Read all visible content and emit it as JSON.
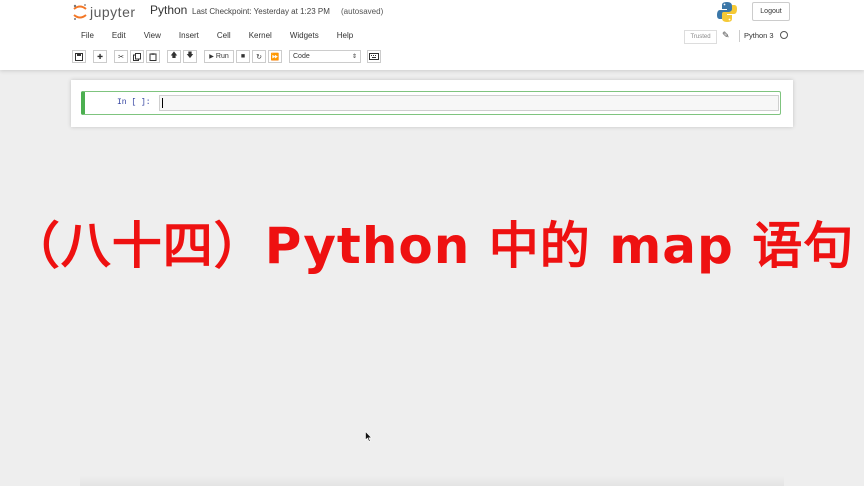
{
  "header": {
    "logo_text": "jupyter",
    "notebook_name": "Python",
    "checkpoint_text": "Last Checkpoint: Yesterday at 1:23 PM",
    "autosave_text": "(autosaved)",
    "logout_label": "Logout"
  },
  "menu": {
    "items": [
      "File",
      "Edit",
      "View",
      "Insert",
      "Cell",
      "Kernel",
      "Widgets",
      "Help"
    ]
  },
  "status": {
    "trusted_label": "Trusted",
    "kernel_name": "Python 3"
  },
  "toolbar": {
    "run_label": "Run",
    "cell_type": "Code"
  },
  "cell": {
    "prompt": "In [ ]:",
    "code": ""
  },
  "overlay": {
    "title": "（八十四）Python 中的 map 语句"
  },
  "colors": {
    "title_red": "#ee1111",
    "cell_green": "#4caf50",
    "jupyter_orange": "#f37726"
  }
}
